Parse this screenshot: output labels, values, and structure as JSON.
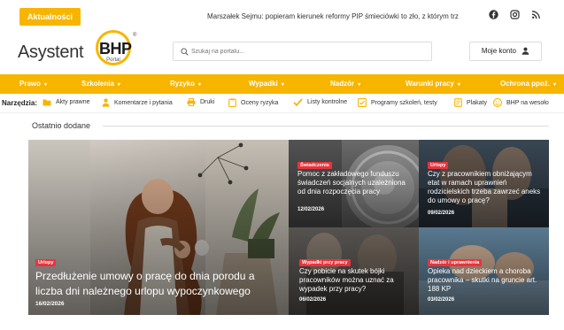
{
  "topbar": {
    "news_badge": "Aktualności",
    "ticker": "Marszałek Sejmu: popieram kierunek reformy PIP śmieciówki to zło, z którym trz",
    "social": [
      "facebook-icon",
      "instagram-icon",
      "rss-icon"
    ]
  },
  "brand": {
    "logo_word": "Asystent",
    "logo_mark": "BHP",
    "logo_sub": "Portal",
    "logo_reg": "®"
  },
  "search": {
    "placeholder": "Szukaj na portalu..."
  },
  "account": {
    "label": "Moje konto"
  },
  "nav": {
    "items": [
      {
        "label": "Prawo"
      },
      {
        "label": "Szkolenia"
      },
      {
        "label": "Ryzyko"
      },
      {
        "label": "Wypadki"
      },
      {
        "label": "Nadzór"
      },
      {
        "label": "Warunki pracy"
      },
      {
        "label": "Ochrona ppoż."
      }
    ],
    "caret": "▾"
  },
  "tools": {
    "label": "Narzędzia:",
    "items": [
      {
        "label": "Akty prawne",
        "icon": "folder-icon"
      },
      {
        "label": "Komentarze i pytania",
        "icon": "person-icon"
      },
      {
        "label": "Druki",
        "icon": "printer-icon"
      },
      {
        "label": "Oceny ryzyka",
        "icon": "clipboard-icon"
      },
      {
        "label": "Listy kontrolne",
        "icon": "check-icon"
      },
      {
        "label": "Programy szkoleń, testy",
        "icon": "checkbox-icon"
      },
      {
        "label": "Plakaty",
        "icon": "poster-icon"
      },
      {
        "label": "BHP na wesoło",
        "icon": "smile-icon"
      }
    ]
  },
  "recent": {
    "title": "Ostatnio dodane",
    "hero": {
      "category": "Urlopy",
      "title": "Przedłużenie umowy o pracę do dnia porodu a liczba dni należnego urlopu wypoczynkowego",
      "date": "16/02/2026"
    },
    "tiles": [
      {
        "category": "Świadczenia",
        "title": "Pomoc z zakładowego funduszu świadczeń socjalnych uzależniona od dnia rozpoczęcia pracy",
        "date": "12/02/2026"
      },
      {
        "category": "Urlopy",
        "title": "Czy z pracownikiem obniżającym etat w ramach uprawnień rodzicielskich trzeba zawrzeć aneks do umowy o pracę?",
        "date": "09/02/2026"
      },
      {
        "category": "Wypadki przy pracy",
        "title": "Czy pobicie na skutek bójki pracowników można uznać za wypadek przy pracy?",
        "date": "06/02/2026"
      },
      {
        "category": "Nadzór i uprawnienia",
        "title": "Opieka nad dzieckiem a choroba pracownika – skutki na gruncie art. 188 KP",
        "date": "03/02/2026"
      }
    ]
  },
  "colors": {
    "accent": "#f7b500",
    "category": "#e8343c"
  }
}
